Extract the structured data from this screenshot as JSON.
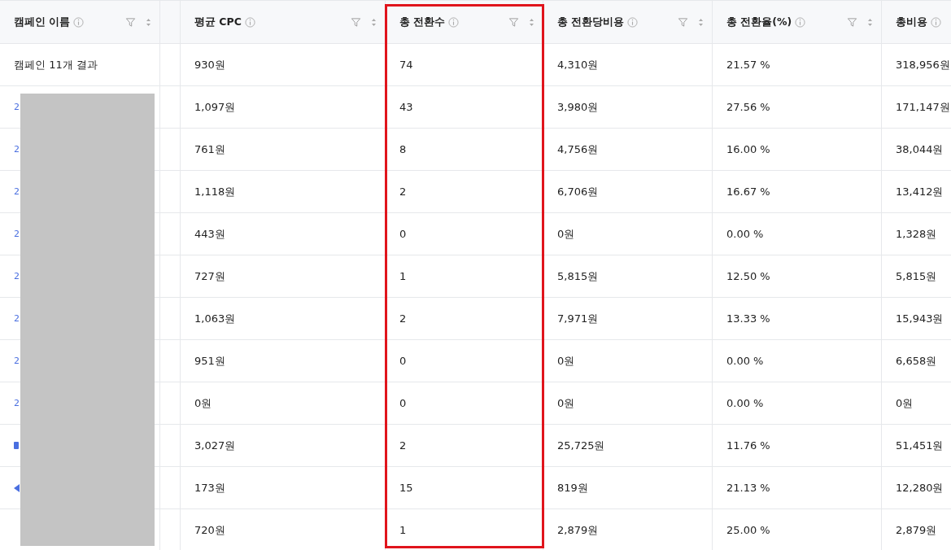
{
  "table": {
    "columns": [
      {
        "label": "캠페인 이름",
        "highlighted": false
      },
      {
        "label": "평균 CPC",
        "highlighted": false
      },
      {
        "label": "총 전환수",
        "highlighted": true
      },
      {
        "label": "총 전환당비용",
        "highlighted": false
      },
      {
        "label": "총 전환율(%)",
        "highlighted": false
      },
      {
        "label": "총비용",
        "highlighted": false
      }
    ],
    "summary": [
      "캠페인 11개 결과",
      "930원",
      "74",
      "4,310원",
      "21.57 %",
      "318,956원"
    ],
    "rows": [
      {
        "name": {
          "kind": "text",
          "text": "2"
        },
        "values": [
          "1,097원",
          "43",
          "3,980원",
          "27.56 %",
          "171,147원"
        ]
      },
      {
        "name": {
          "kind": "text",
          "text": "2"
        },
        "values": [
          "761원",
          "8",
          "4,756원",
          "16.00 %",
          "38,044원"
        ]
      },
      {
        "name": {
          "kind": "text",
          "text": "2"
        },
        "values": [
          "1,118원",
          "2",
          "6,706원",
          "16.67 %",
          "13,412원"
        ]
      },
      {
        "name": {
          "kind": "text",
          "text": "2"
        },
        "values": [
          "443원",
          "0",
          "0원",
          "0.00 %",
          "1,328원"
        ]
      },
      {
        "name": {
          "kind": "text",
          "text": "2"
        },
        "values": [
          "727원",
          "1",
          "5,815원",
          "12.50 %",
          "5,815원"
        ]
      },
      {
        "name": {
          "kind": "text",
          "text": "2"
        },
        "values": [
          "1,063원",
          "2",
          "7,971원",
          "13.33 %",
          "15,943원"
        ]
      },
      {
        "name": {
          "kind": "text",
          "text": "2"
        },
        "values": [
          "951원",
          "0",
          "0원",
          "0.00 %",
          "6,658원"
        ]
      },
      {
        "name": {
          "kind": "text",
          "text": "2"
        },
        "values": [
          "0원",
          "0",
          "0원",
          "0.00 %",
          "0원"
        ]
      },
      {
        "name": {
          "kind": "square"
        },
        "values": [
          "3,027원",
          "2",
          "25,725원",
          "11.76 %",
          "51,451원"
        ]
      },
      {
        "name": {
          "kind": "triangle"
        },
        "values": [
          "173원",
          "15",
          "819원",
          "21.13 %",
          "12,280원"
        ]
      },
      {
        "name": {
          "kind": "blank"
        },
        "values": [
          "720원",
          "1",
          "2,879원",
          "25.00 %",
          "2,879원"
        ]
      }
    ]
  }
}
